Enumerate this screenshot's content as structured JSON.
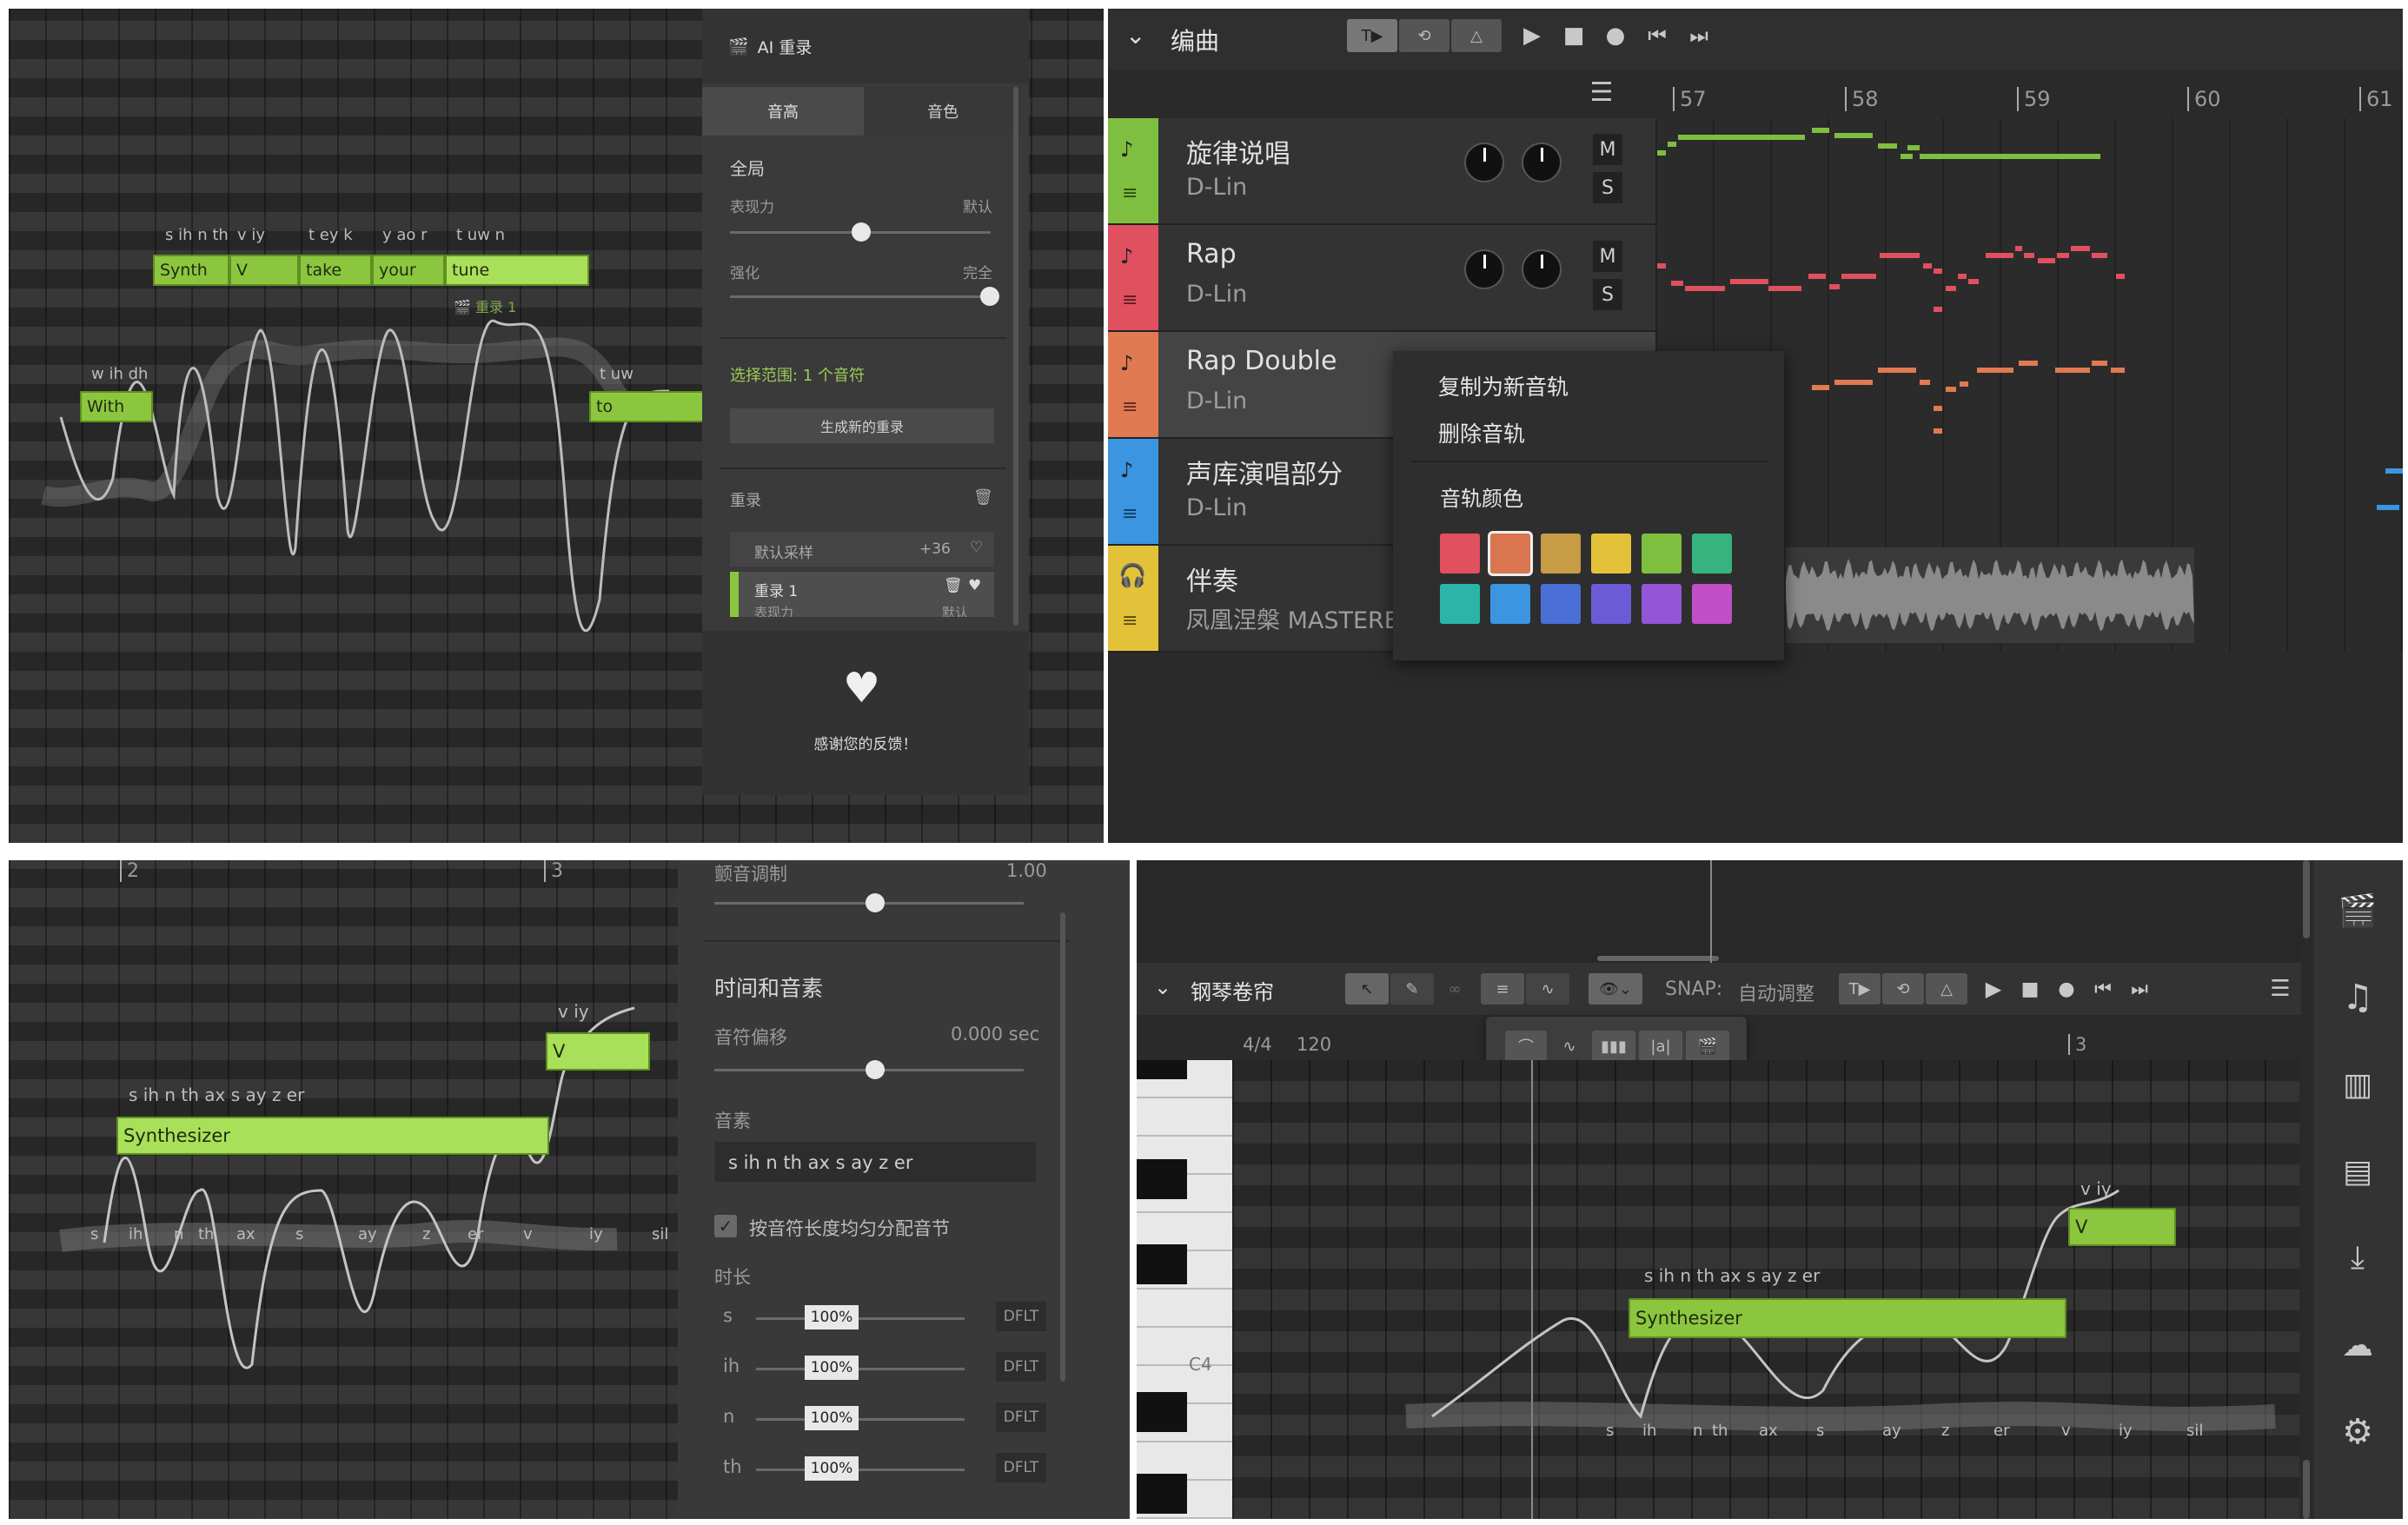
{
  "q1": {
    "phonemes": [
      {
        "t": "w ih dh"
      },
      {
        "t": "s ih n th"
      },
      {
        "t": "v iy"
      },
      {
        "t": "t ey k"
      },
      {
        "t": "y ao r"
      },
      {
        "t": "t uw n"
      },
      {
        "t": "t uw"
      }
    ],
    "notes": [
      "With",
      "Synth",
      "V",
      "take",
      "your",
      "tune",
      "to"
    ],
    "retake_tag": "重录 1",
    "panel": {
      "title": "AI 重录",
      "tabs": [
        "音高",
        "音色"
      ],
      "section": "全局",
      "expr_label": "表现力",
      "expr_value": "默认",
      "strength_label": "强化",
      "strength_value": "完全",
      "selection": "选择范围: 1 个音符",
      "gen_button": "生成新的重录",
      "retake_header": "重录",
      "row1": "默认采样",
      "row1_val": "+36",
      "row2": "重录 1",
      "row2_sub": "表现力",
      "row2_subval": "默认",
      "thanks": "感谢您的反馈！"
    }
  },
  "q2": {
    "header": {
      "title": "编曲",
      "bars": [
        "57",
        "58",
        "59",
        "60",
        "61"
      ]
    },
    "tracks": [
      {
        "name": "旋律说唱",
        "sub": "D-Lin",
        "color": "#7fbf3f"
      },
      {
        "name": "Rap",
        "sub": "D-Lin",
        "color": "#e0505f"
      },
      {
        "name": "Rap Double",
        "sub": "D-Lin",
        "color": "#e07a52"
      },
      {
        "name": "声库演唱部分",
        "sub": "D-Lin",
        "color": "#3b95e0"
      },
      {
        "name": "伴奏",
        "sub": "凤凰涅槃 MASTERED",
        "color": "#e3c23a"
      }
    ],
    "m": "M",
    "s": "S",
    "menu": {
      "item1": "复制为新音轨",
      "item2": "删除音轨",
      "color_title": "音轨颜色",
      "colors": [
        "#e0505f",
        "#d9754f",
        "#c89c45",
        "#e3c23a",
        "#7fbf3f",
        "#36b37e",
        "#2bb5a8",
        "#3b95e0",
        "#4a6fd6",
        "#6b5bd6",
        "#9456d6",
        "#c04fc9"
      ]
    }
  },
  "q3": {
    "bars": [
      "2",
      "3"
    ],
    "phonemes_top": "s ih n th ax s ay z er",
    "note": "Synthesizer",
    "note2_ph": "v iy",
    "note2": "V",
    "ph_row": [
      "s",
      "ih",
      "n",
      "th",
      "ax",
      "s",
      "ay",
      "z",
      "er",
      "v",
      "iy",
      "sil"
    ],
    "panel": {
      "vibrato_label": "颤音调制",
      "vibrato_val": "1.00",
      "section": "时间和音素",
      "offset_label": "音符偏移",
      "offset_val": "0.000 sec",
      "phoneme_label": "音素",
      "phoneme_val": "s ih n th ax s ay z er",
      "checkbox": "按音符长度均匀分配音节",
      "dur_label": "时长",
      "dur_rows": [
        {
          "p": "s",
          "v": "100%",
          "d": "DFLT"
        },
        {
          "p": "ih",
          "v": "100%",
          "d": "DFLT"
        },
        {
          "p": "n",
          "v": "100%",
          "d": "DFLT"
        },
        {
          "p": "th",
          "v": "100%",
          "d": "DFLT"
        }
      ]
    }
  },
  "q4": {
    "title": "钢琴卷帘",
    "snap_label": "SNAP:",
    "snap_value": "自动调整",
    "sig": "4/4",
    "tempo": "120",
    "bar": "3",
    "key_label": "C4",
    "phonemes_top": "s ih n th ax s ay z er",
    "note": "Synthesizer",
    "note2_ph": "v iy",
    "note2": "V",
    "ph_row": [
      "s",
      "ih",
      "n",
      "th",
      "ax",
      "s",
      "ay",
      "z",
      "er",
      "v",
      "iy",
      "sil"
    ]
  }
}
